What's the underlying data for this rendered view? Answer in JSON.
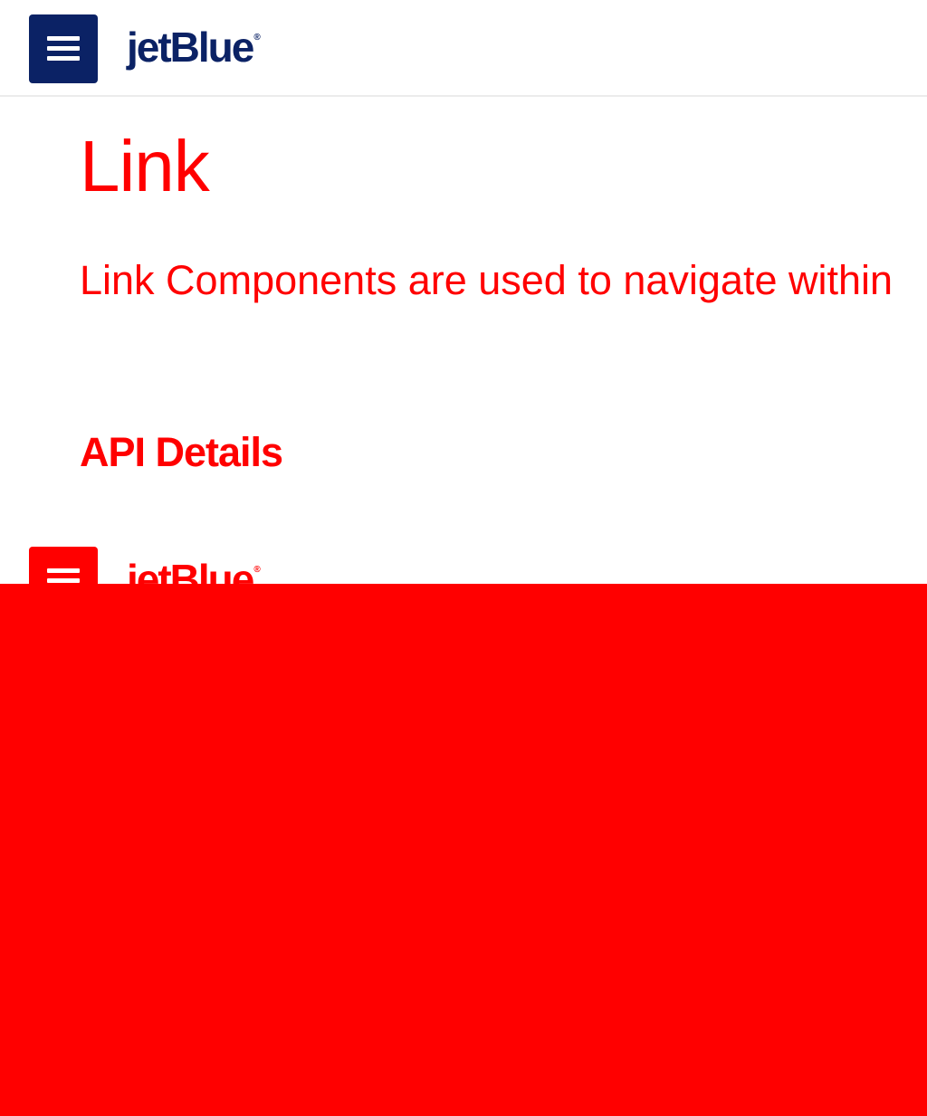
{
  "header": {
    "menu_icon": "hamburger-menu-icon",
    "logo_text": "jetBlue",
    "logo_mark": "®",
    "brand_color": "#0b2265"
  },
  "main": {
    "title": "Link",
    "description": "Link Components are used to navigate within",
    "section_heading": "API Details",
    "text_color": "#ff0000"
  },
  "overlay": {
    "logo_text": "jetBlue",
    "logo_mark": "®",
    "color": "#ff0000"
  }
}
